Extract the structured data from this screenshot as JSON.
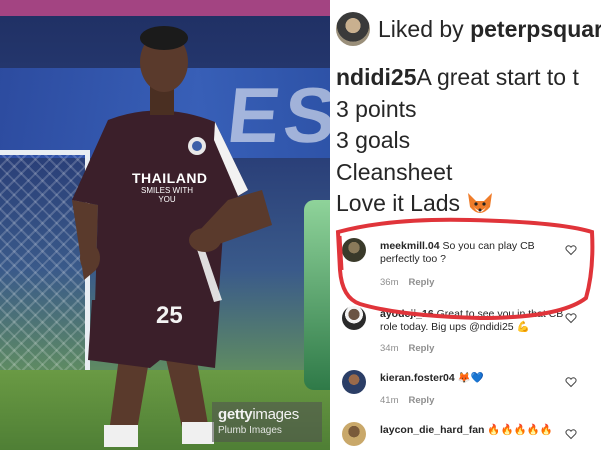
{
  "photo": {
    "jersey_sponsor_line1": "THAILAND",
    "jersey_sponsor_line2": "SMILES WITH YOU",
    "shirt_number": "25",
    "banner_text": "ES",
    "watermark": {
      "brand_main": "getty",
      "brand_sub": "images",
      "credit": "Plumb Images"
    },
    "colors": {
      "jersey": "#3b1f2a",
      "highlight": "#e0343a"
    }
  },
  "post": {
    "liked_by_prefix": "Liked by ",
    "liked_by_user": "peterpsquar",
    "caption_user": "ndidi25",
    "caption_first_line": " A great start to t",
    "caption_lines": [
      "3 points",
      "3 goals",
      "Cleansheet",
      "Love it Lads"
    ]
  },
  "comments": [
    {
      "user": "meekmill.04",
      "text": " So you can play CB perfectly too ?",
      "age": "36m",
      "reply": "Reply"
    },
    {
      "user": "ayodeji_16",
      "text": " Great to see you in that CB role today. Big ups @ndidi25 💪",
      "age": "34m",
      "reply": "Reply"
    },
    {
      "user": "kieran.foster04",
      "text": " 🦊💙",
      "age": "41m",
      "reply": "Reply"
    },
    {
      "user": "laycon_die_hard_fan",
      "text": " 🔥🔥🔥🔥🔥",
      "age": "",
      "reply": ""
    }
  ],
  "icons": [
    "avatar",
    "fox-emoji-icon",
    "heart-outline-icon"
  ]
}
